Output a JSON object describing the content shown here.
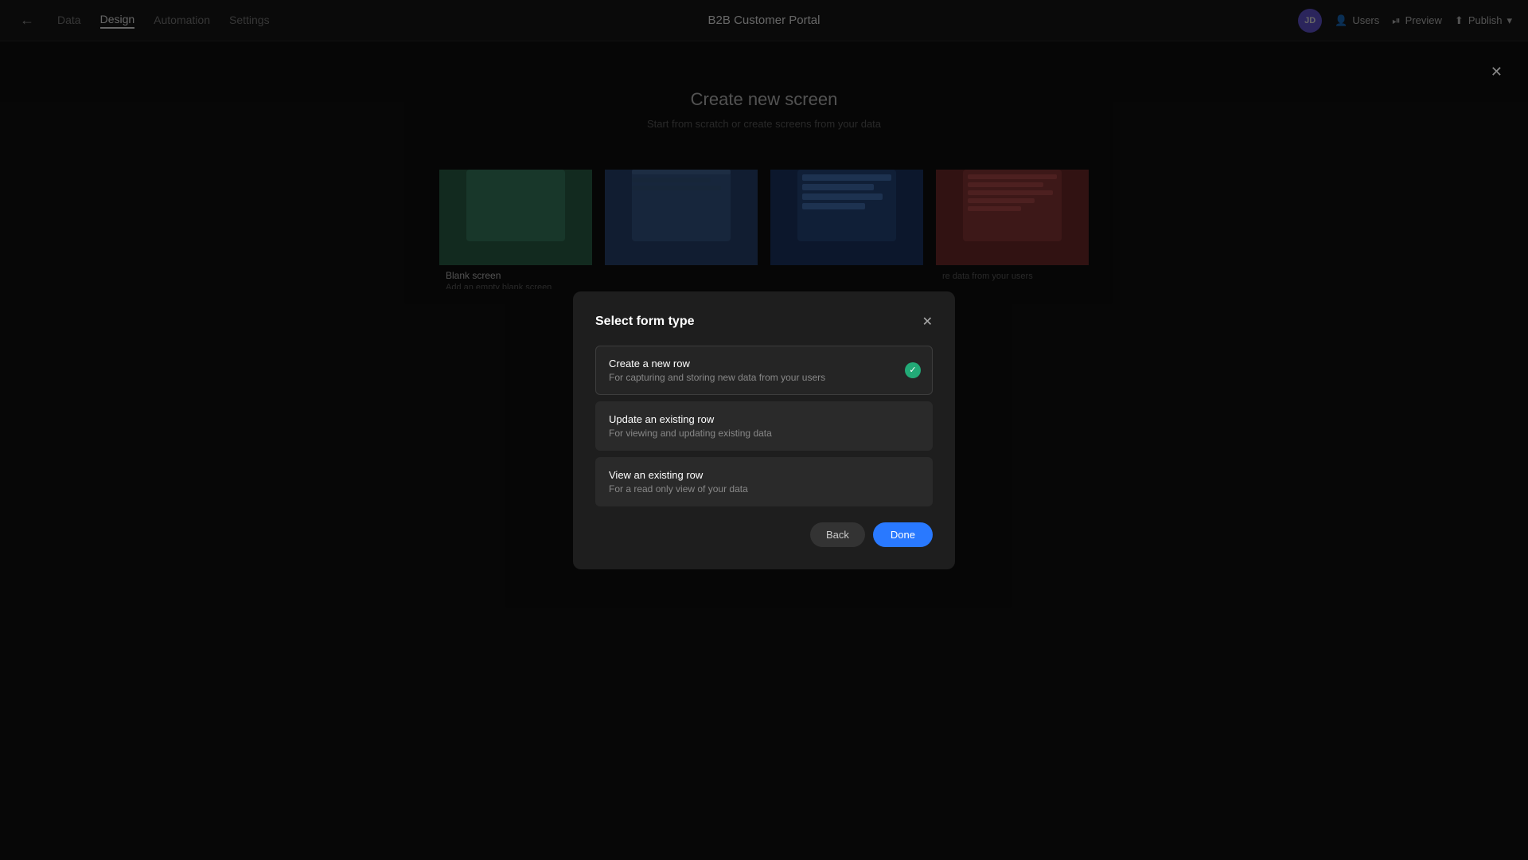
{
  "app": {
    "title": "B2B Customer Portal"
  },
  "nav": {
    "back_icon": "←",
    "tabs": [
      {
        "label": "Data",
        "active": false
      },
      {
        "label": "Design",
        "active": true
      },
      {
        "label": "Automation",
        "active": false
      },
      {
        "label": "Settings",
        "active": false
      }
    ],
    "avatar_initials": "JD",
    "users_label": "Users",
    "preview_label": "Preview",
    "publish_label": "Publish"
  },
  "background": {
    "title": "Create new screen",
    "subtitle": "Start from scratch or create screens from your data",
    "cards": [
      {
        "label": "Blank screen",
        "desc": "Add an empty blank screen",
        "type": "green"
      },
      {
        "label": "",
        "desc": "",
        "type": "blue1"
      },
      {
        "label": "",
        "desc": "",
        "type": "blue2"
      },
      {
        "label": "",
        "desc": "re data from your users",
        "type": "red"
      }
    ]
  },
  "modal": {
    "title": "Select form type",
    "close_icon": "✕",
    "options": [
      {
        "id": "create",
        "title": "Create a new row",
        "desc": "For capturing and storing new data from your users",
        "selected": true
      },
      {
        "id": "update",
        "title": "Update an existing row",
        "desc": "For viewing and updating existing data",
        "selected": false
      },
      {
        "id": "view",
        "title": "View an existing row",
        "desc": "For a read only view of your data",
        "selected": false
      }
    ],
    "back_label": "Back",
    "done_label": "Done"
  },
  "corner_close": "✕"
}
